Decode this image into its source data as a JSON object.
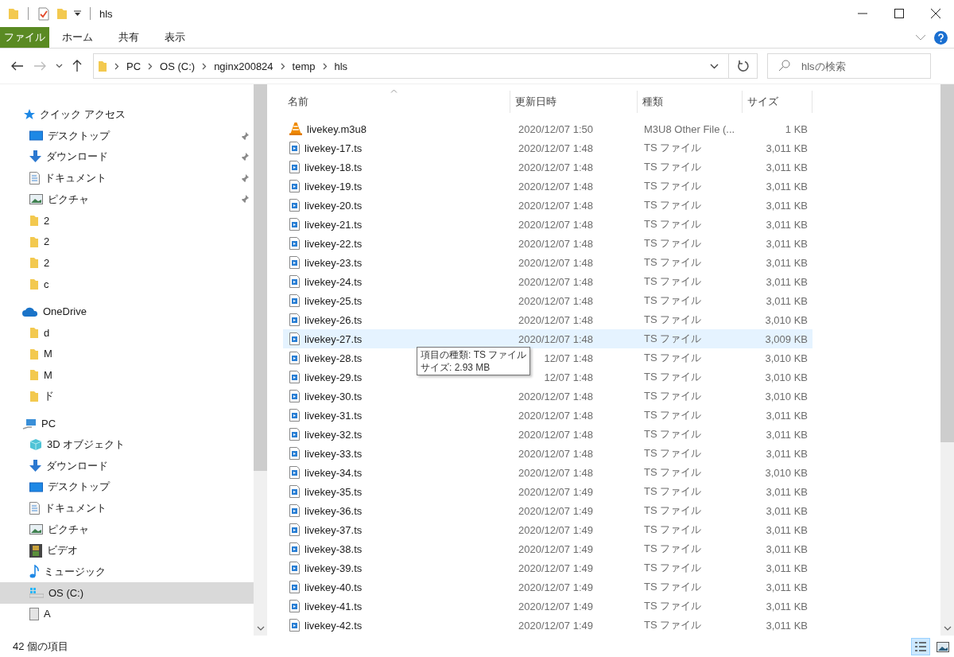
{
  "window": {
    "title": "hls"
  },
  "ribbon": {
    "file_tab": "ファイル",
    "tabs": [
      "ホーム",
      "共有",
      "表示"
    ]
  },
  "address": {
    "crumbs": [
      "PC",
      "OS (C:)",
      "nginx200824",
      "temp",
      "hls"
    ]
  },
  "search": {
    "placeholder": "hlsの検索"
  },
  "sidebar": {
    "sections": [
      {
        "label": "クイック アクセス",
        "kind": "star",
        "selected": false,
        "children": [
          {
            "label": "デスクトップ",
            "kind": "desktop",
            "pinned": true,
            "selected": false
          },
          {
            "label": "ダウンロード",
            "kind": "download",
            "pinned": true,
            "selected": false
          },
          {
            "label": "ドキュメント",
            "kind": "document",
            "pinned": true,
            "selected": false
          },
          {
            "label": "ピクチャ",
            "kind": "picture",
            "pinned": true,
            "selected": false
          },
          {
            "label": "2",
            "kind": "folder",
            "pinned": false,
            "selected": false
          },
          {
            "label": "2",
            "kind": "folder",
            "pinned": false,
            "selected": false
          },
          {
            "label": "2",
            "kind": "folder",
            "pinned": false,
            "selected": false
          },
          {
            "label": "c",
            "kind": "folder",
            "pinned": false,
            "selected": false
          }
        ]
      },
      {
        "label": "OneDrive",
        "kind": "cloud",
        "selected": false,
        "children": [
          {
            "label": "d",
            "kind": "folder",
            "pinned": false,
            "selected": false
          },
          {
            "label": "M",
            "kind": "folder",
            "pinned": false,
            "selected": false
          },
          {
            "label": "M",
            "kind": "folder",
            "pinned": false,
            "selected": false
          },
          {
            "label": "ド",
            "kind": "folder",
            "pinned": false,
            "selected": false
          }
        ]
      },
      {
        "label": "PC",
        "kind": "pc",
        "selected": false,
        "children": [
          {
            "label": "3D オブジェクト",
            "kind": "cube",
            "pinned": false,
            "selected": false
          },
          {
            "label": "ダウンロード",
            "kind": "download",
            "pinned": false,
            "selected": false
          },
          {
            "label": "デスクトップ",
            "kind": "desktop",
            "pinned": false,
            "selected": false
          },
          {
            "label": "ドキュメント",
            "kind": "document",
            "pinned": false,
            "selected": false
          },
          {
            "label": "ピクチャ",
            "kind": "picture",
            "pinned": false,
            "selected": false
          },
          {
            "label": "ビデオ",
            "kind": "video",
            "pinned": false,
            "selected": false
          },
          {
            "label": "ミュージック",
            "kind": "music",
            "pinned": false,
            "selected": false
          },
          {
            "label": "OS (C:)",
            "kind": "drive",
            "pinned": false,
            "selected": true
          },
          {
            "label": "A",
            "kind": "disk",
            "pinned": false,
            "selected": false
          }
        ]
      }
    ]
  },
  "table": {
    "columns": [
      {
        "label": "名前",
        "sorted": true
      },
      {
        "label": "更新日時",
        "sorted": false
      },
      {
        "label": "種類",
        "sorted": false
      },
      {
        "label": "サイズ",
        "sorted": false
      }
    ],
    "rows": [
      {
        "name": "livekey.m3u8",
        "kind": "playlist",
        "date": "2020/12/07 1:50",
        "type": "M3U8 Other File (...",
        "size": "1 KB",
        "hovered": false
      },
      {
        "name": "livekey-17.ts",
        "kind": "ts",
        "date": "2020/12/07 1:48",
        "type": "TS ファイル",
        "size": "3,011 KB",
        "hovered": false
      },
      {
        "name": "livekey-18.ts",
        "kind": "ts",
        "date": "2020/12/07 1:48",
        "type": "TS ファイル",
        "size": "3,011 KB",
        "hovered": false
      },
      {
        "name": "livekey-19.ts",
        "kind": "ts",
        "date": "2020/12/07 1:48",
        "type": "TS ファイル",
        "size": "3,011 KB",
        "hovered": false
      },
      {
        "name": "livekey-20.ts",
        "kind": "ts",
        "date": "2020/12/07 1:48",
        "type": "TS ファイル",
        "size": "3,011 KB",
        "hovered": false
      },
      {
        "name": "livekey-21.ts",
        "kind": "ts",
        "date": "2020/12/07 1:48",
        "type": "TS ファイル",
        "size": "3,011 KB",
        "hovered": false
      },
      {
        "name": "livekey-22.ts",
        "kind": "ts",
        "date": "2020/12/07 1:48",
        "type": "TS ファイル",
        "size": "3,011 KB",
        "hovered": false
      },
      {
        "name": "livekey-23.ts",
        "kind": "ts",
        "date": "2020/12/07 1:48",
        "type": "TS ファイル",
        "size": "3,011 KB",
        "hovered": false
      },
      {
        "name": "livekey-24.ts",
        "kind": "ts",
        "date": "2020/12/07 1:48",
        "type": "TS ファイル",
        "size": "3,011 KB",
        "hovered": false
      },
      {
        "name": "livekey-25.ts",
        "kind": "ts",
        "date": "2020/12/07 1:48",
        "type": "TS ファイル",
        "size": "3,011 KB",
        "hovered": false
      },
      {
        "name": "livekey-26.ts",
        "kind": "ts",
        "date": "2020/12/07 1:48",
        "type": "TS ファイル",
        "size": "3,010 KB",
        "hovered": false
      },
      {
        "name": "livekey-27.ts",
        "kind": "ts",
        "date": "2020/12/07 1:48",
        "type": "TS ファイル",
        "size": "3,009 KB",
        "hovered": true
      },
      {
        "name": "livekey-28.ts",
        "kind": "ts",
        "date": "12/07 1:48",
        "type": "TS ファイル",
        "size": "3,010 KB",
        "hovered": false
      },
      {
        "name": "livekey-29.ts",
        "kind": "ts",
        "date": "12/07 1:48",
        "type": "TS ファイル",
        "size": "3,010 KB",
        "hovered": false
      },
      {
        "name": "livekey-30.ts",
        "kind": "ts",
        "date": "2020/12/07 1:48",
        "type": "TS ファイル",
        "size": "3,010 KB",
        "hovered": false
      },
      {
        "name": "livekey-31.ts",
        "kind": "ts",
        "date": "2020/12/07 1:48",
        "type": "TS ファイル",
        "size": "3,011 KB",
        "hovered": false
      },
      {
        "name": "livekey-32.ts",
        "kind": "ts",
        "date": "2020/12/07 1:48",
        "type": "TS ファイル",
        "size": "3,011 KB",
        "hovered": false
      },
      {
        "name": "livekey-33.ts",
        "kind": "ts",
        "date": "2020/12/07 1:48",
        "type": "TS ファイル",
        "size": "3,011 KB",
        "hovered": false
      },
      {
        "name": "livekey-34.ts",
        "kind": "ts",
        "date": "2020/12/07 1:48",
        "type": "TS ファイル",
        "size": "3,010 KB",
        "hovered": false
      },
      {
        "name": "livekey-35.ts",
        "kind": "ts",
        "date": "2020/12/07 1:49",
        "type": "TS ファイル",
        "size": "3,011 KB",
        "hovered": false
      },
      {
        "name": "livekey-36.ts",
        "kind": "ts",
        "date": "2020/12/07 1:49",
        "type": "TS ファイル",
        "size": "3,011 KB",
        "hovered": false
      },
      {
        "name": "livekey-37.ts",
        "kind": "ts",
        "date": "2020/12/07 1:49",
        "type": "TS ファイル",
        "size": "3,011 KB",
        "hovered": false
      },
      {
        "name": "livekey-38.ts",
        "kind": "ts",
        "date": "2020/12/07 1:49",
        "type": "TS ファイル",
        "size": "3,011 KB",
        "hovered": false
      },
      {
        "name": "livekey-39.ts",
        "kind": "ts",
        "date": "2020/12/07 1:49",
        "type": "TS ファイル",
        "size": "3,011 KB",
        "hovered": false
      },
      {
        "name": "livekey-40.ts",
        "kind": "ts",
        "date": "2020/12/07 1:49",
        "type": "TS ファイル",
        "size": "3,011 KB",
        "hovered": false
      },
      {
        "name": "livekey-41.ts",
        "kind": "ts",
        "date": "2020/12/07 1:49",
        "type": "TS ファイル",
        "size": "3,011 KB",
        "hovered": false
      },
      {
        "name": "livekey-42.ts",
        "kind": "ts",
        "date": "2020/12/07 1:49",
        "type": "TS ファイル",
        "size": "3,011 KB",
        "hovered": false
      }
    ]
  },
  "tooltip": {
    "lines": [
      "項目の種類: TS ファイル",
      "サイズ: 2.93 MB"
    ]
  },
  "status_bar": {
    "count": "42 個の項目"
  },
  "view_buttons": [
    {
      "kind": "details",
      "selected": true
    },
    {
      "kind": "tiles",
      "selected": false
    }
  ]
}
